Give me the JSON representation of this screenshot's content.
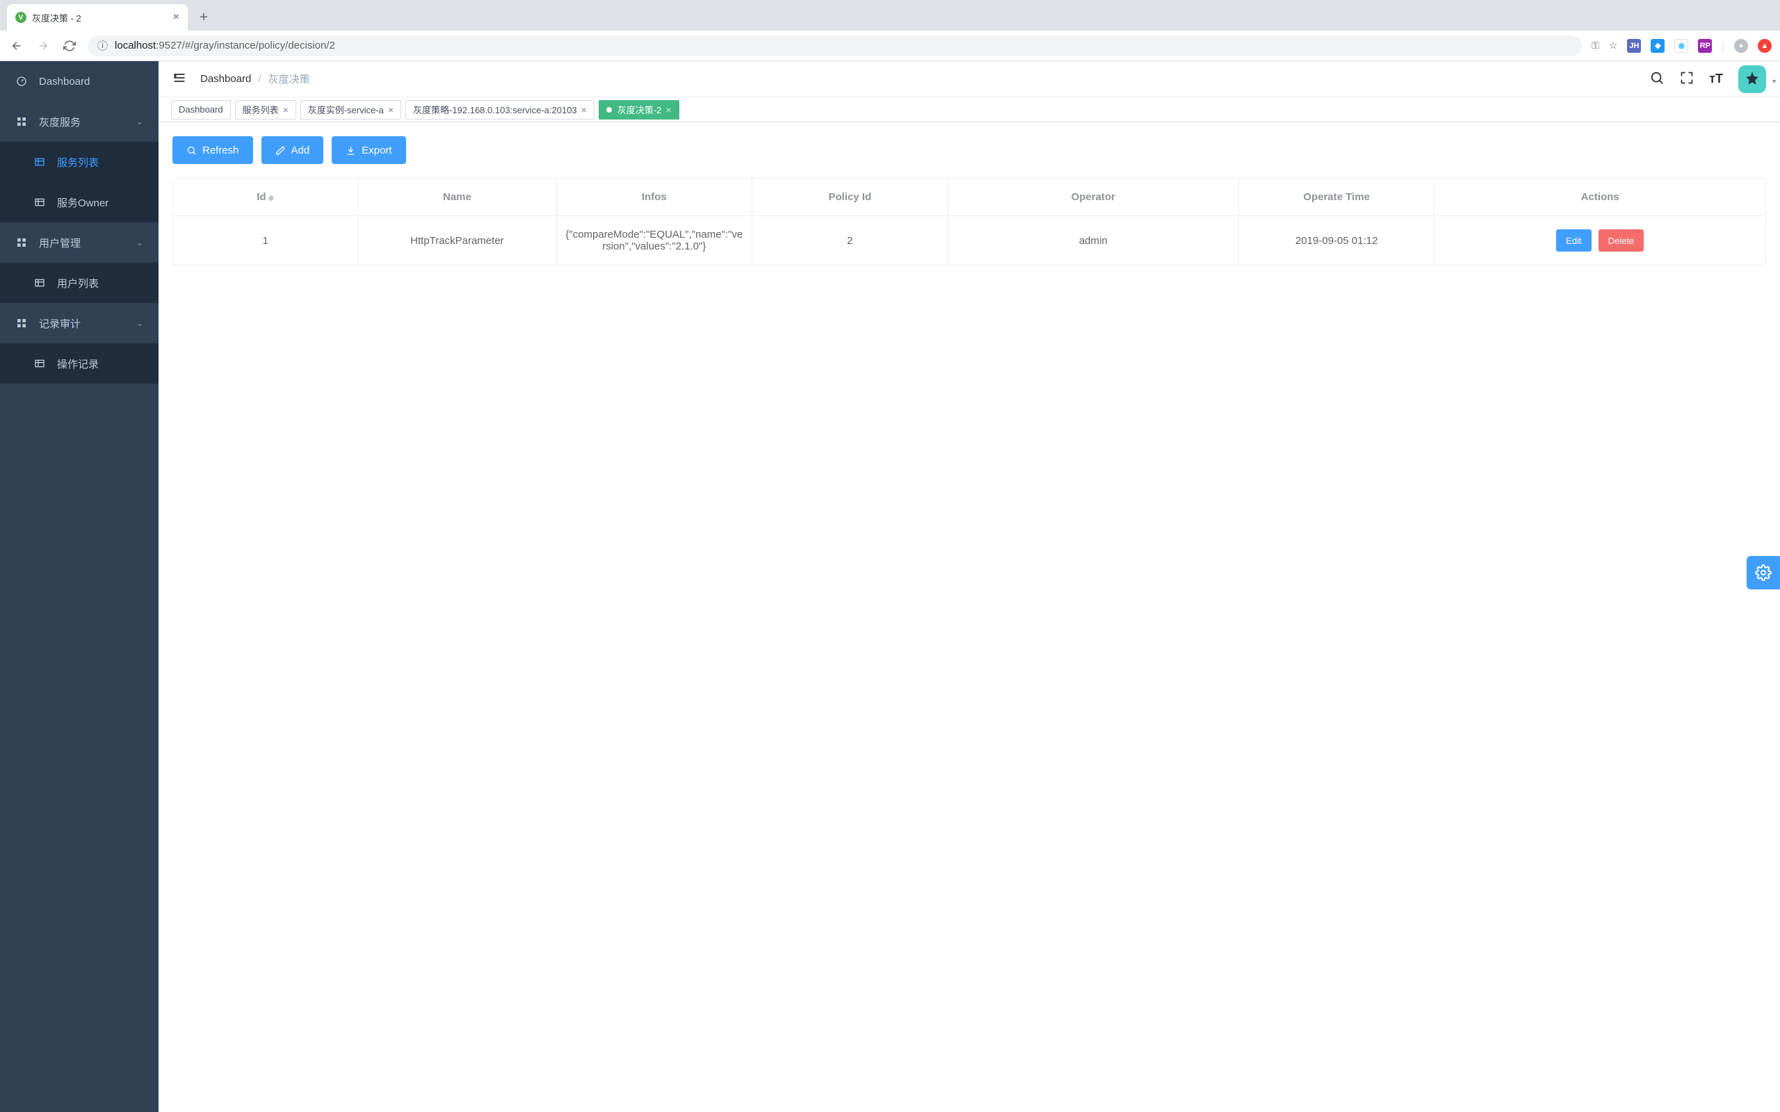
{
  "browser": {
    "tab_title": "灰度决策 - 2",
    "url_host": "localhost",
    "url_port_path": ":9527/#/gray/instance/policy/decision/2"
  },
  "breadcrumb": {
    "home": "Dashboard",
    "current": "灰度决策"
  },
  "sidebar": {
    "dashboard": "Dashboard",
    "gray_service": "灰度服务",
    "service_list": "服务列表",
    "service_owner": "服务Owner",
    "user_mgmt": "用户管理",
    "user_list": "用户列表",
    "audit": "记录审计",
    "op_log": "操作记录"
  },
  "view_tabs": [
    {
      "label": "Dashboard",
      "closable": false,
      "active": false
    },
    {
      "label": "服务列表",
      "closable": true,
      "active": false
    },
    {
      "label": "灰度实例-service-a",
      "closable": true,
      "active": false
    },
    {
      "label": "灰度策略-192.168.0.103:service-a:20103",
      "closable": true,
      "active": false
    },
    {
      "label": "灰度决策-2",
      "closable": true,
      "active": true
    }
  ],
  "buttons": {
    "refresh": "Refresh",
    "add": "Add",
    "export": "Export",
    "edit": "Edit",
    "delete": "Delete"
  },
  "table": {
    "headers": {
      "id": "Id",
      "name": "Name",
      "infos": "Infos",
      "policy_id": "Policy Id",
      "operator": "Operator",
      "operate_time": "Operate Time",
      "actions": "Actions"
    },
    "rows": [
      {
        "id": "1",
        "name": "HttpTrackParameter",
        "infos": "{\"compareMode\":\"EQUAL\",\"name\":\"version\",\"values\":\"2.1.0\"}",
        "policy_id": "2",
        "operator": "admin",
        "operate_time": "2019-09-05 01:12"
      }
    ]
  }
}
